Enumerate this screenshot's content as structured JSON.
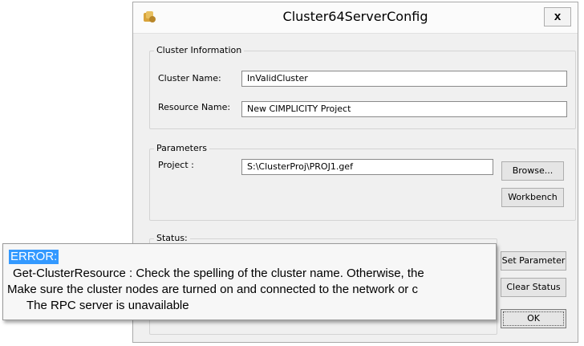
{
  "window": {
    "title": "Cluster64ServerConfig",
    "close_glyph": "x",
    "icon": "app-icon"
  },
  "cluster_info": {
    "group_label": "Cluster Information",
    "cluster_name_label": "Cluster Name:",
    "cluster_name_value": "InValidCluster",
    "resource_name_label": "Resource Name:",
    "resource_name_value": "New CIMPLICITY Project"
  },
  "parameters": {
    "group_label": "Parameters",
    "project_label": "Project :",
    "project_value": "S:\\ClusterProj\\PROJ1.gef",
    "browse_label": "Browse...",
    "workbench_label": "Workbench"
  },
  "status": {
    "group_label": "Status:"
  },
  "buttons": {
    "set_parameter": "Set Parameter",
    "clear_status": "Clear Status",
    "ok": "OK"
  },
  "error_tooltip": {
    "heading": "ERROR:",
    "line1": "Get-ClusterResource : Check the spelling of the cluster name. Otherwise, the",
    "line2": "Make sure the cluster nodes are turned on and connected to the network or c",
    "line3": "The RPC server is unavailable",
    "heading_highlight_color": "#3399ff"
  }
}
